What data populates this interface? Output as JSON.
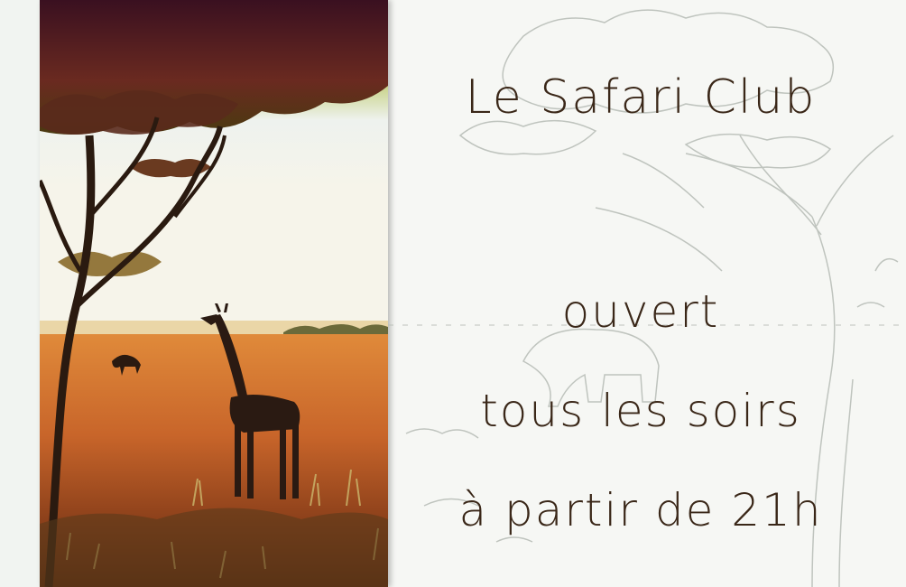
{
  "title": "Le Safari Club",
  "hours": {
    "line1": "ouvert",
    "line2": "tous les soirs",
    "line3": "à partir de 21h"
  },
  "colors": {
    "text": "#3a2718",
    "sky_top": "#7a1f3a",
    "savanna": "#d2762e",
    "sketch": "#9aa09a"
  }
}
